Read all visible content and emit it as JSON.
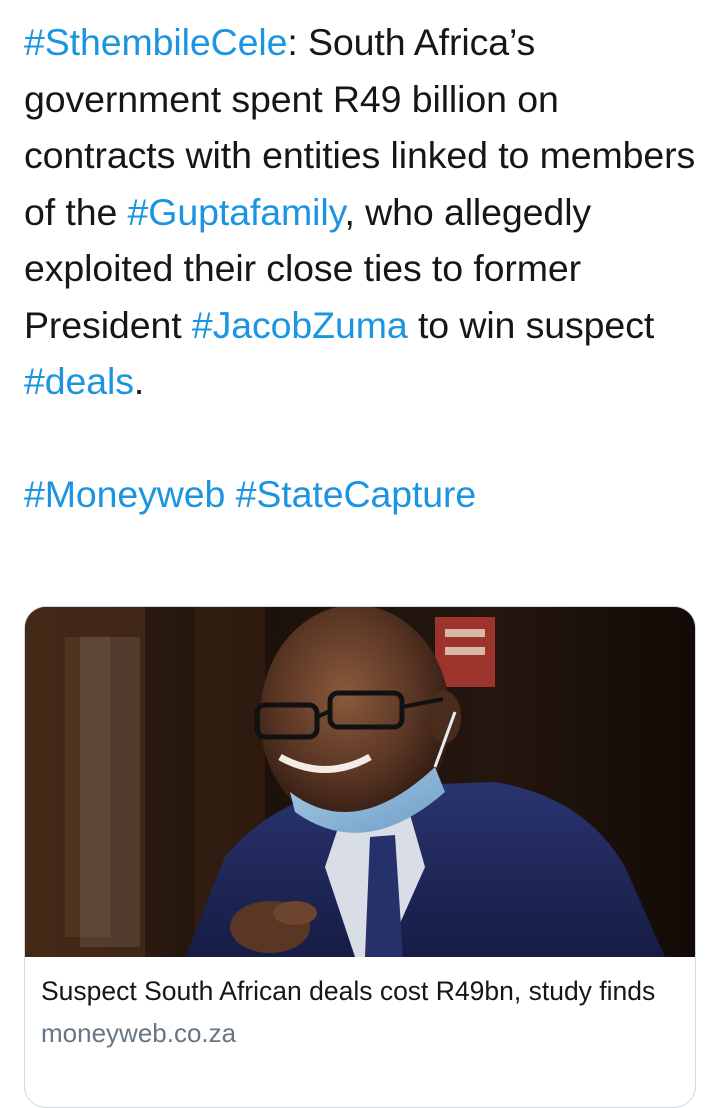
{
  "tweet": {
    "line1": [
      {
        "text": "#SthembileCele",
        "tag": true
      },
      {
        "text": ": South Africa’s government spent R49 billion on contracts with entities linked to members of the ",
        "tag": false
      },
      {
        "text": "#Guptafamily",
        "tag": true
      },
      {
        "text": ", who allegedly exploited their close ties to former President ",
        "tag": false
      },
      {
        "text": "#JacobZuma",
        "tag": true
      },
      {
        "text": " to win suspect ",
        "tag": false
      },
      {
        "text": "#deals",
        "tag": true
      },
      {
        "text": ".",
        "tag": false
      }
    ],
    "hashtag_sthembile": "#SthembileCele",
    "text_a": ": South Africa’s government spent R49 billion on contracts with entities linked to members of the ",
    "hashtag_gupta": "#Guptafamily",
    "text_b": ", who allegedly exploited their close ties to former President ",
    "hashtag_zuma": "#JacobZuma",
    "text_c": " to win suspect ",
    "hashtag_deals": "#deals",
    "text_d": ".",
    "hashtag_moneyweb": "#Moneyweb",
    "hashtag_statecapture": "#StateCapture"
  },
  "card": {
    "title": "Suspect South African deals cost R49bn, study finds",
    "domain": "moneyweb.co.za",
    "image_subject": "man-in-suit-with-face-mask-photo"
  },
  "colors": {
    "hashtag": "#1b95e0",
    "text": "#14171a",
    "secondary": "#657786",
    "card_border": "#cfd9de"
  }
}
